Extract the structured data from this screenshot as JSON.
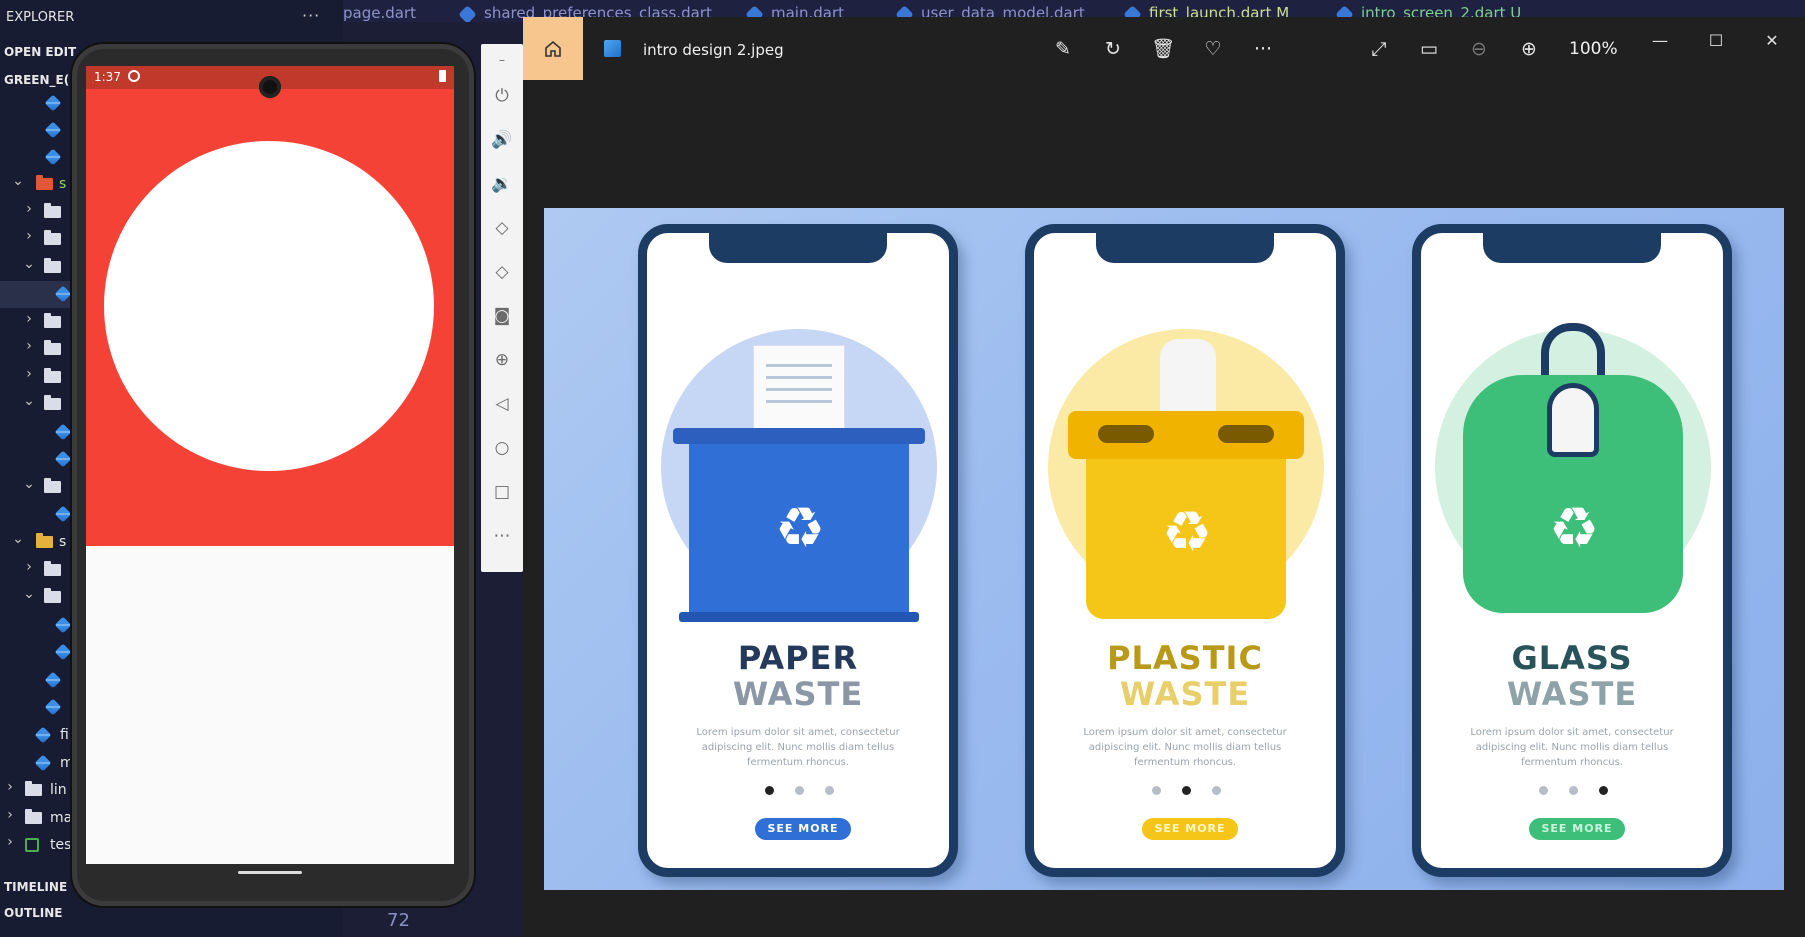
{
  "sidebar": {
    "title": "EXPLORER",
    "more": "···",
    "open_editors": "OPEN EDIT",
    "project": "GREEN_E(",
    "timeline": "TIMELINE",
    "outline": "OUTLINE",
    "tree_labels": {
      "s1": "s",
      "s2": "s",
      "fi": "fi",
      "m": "m",
      "lin": "lin",
      "ma": "ma",
      "tes": "tes"
    }
  },
  "tabs": [
    {
      "label": "page.dart"
    },
    {
      "label": "shared_preferences_class.dart"
    },
    {
      "label": "main.dart"
    },
    {
      "label": "user_data_model.dart"
    },
    {
      "label": "first_launch.dart  M"
    },
    {
      "label": "intro_screen_2.dart  U"
    }
  ],
  "editor": {
    "line_number": "72"
  },
  "emulator": {
    "status_time": "1:37"
  },
  "viewer": {
    "file_name": "intro design 2.jpeg",
    "zoom": "100%",
    "tools": [
      "edit-image-icon",
      "rotate-icon",
      "delete-icon",
      "favorite-icon",
      "more-icon",
      "fullscreen-icon",
      "fit-icon",
      "zoom-out-icon",
      "zoom-in-icon"
    ],
    "accent": "#f7c68f"
  },
  "image": {
    "cards": [
      {
        "title_1": "PAPER",
        "title_2": "WASTE",
        "body": "Lorem ipsum dolor sit amet, consectetur adipiscing elit. Nunc mollis diam tellus fermentum rhoncus.",
        "button": "SEE MORE",
        "accent": "#2f6fd6",
        "active_dot": 0
      },
      {
        "title_1": "PLASTIC",
        "title_2": "WASTE",
        "body": "Lorem ipsum dolor sit amet, consectetur adipiscing elit. Nunc mollis diam tellus fermentum rhoncus.",
        "button": "SEE MORE",
        "accent": "#f5c518",
        "active_dot": 1
      },
      {
        "title_1": "GLASS",
        "title_2": "WASTE",
        "body": "Lorem ipsum dolor sit amet, consectetur adipiscing elit. Nunc mollis diam tellus fermentum rhoncus.",
        "button": "SEE MORE",
        "accent": "#3dbf7a",
        "active_dot": 2
      }
    ]
  }
}
